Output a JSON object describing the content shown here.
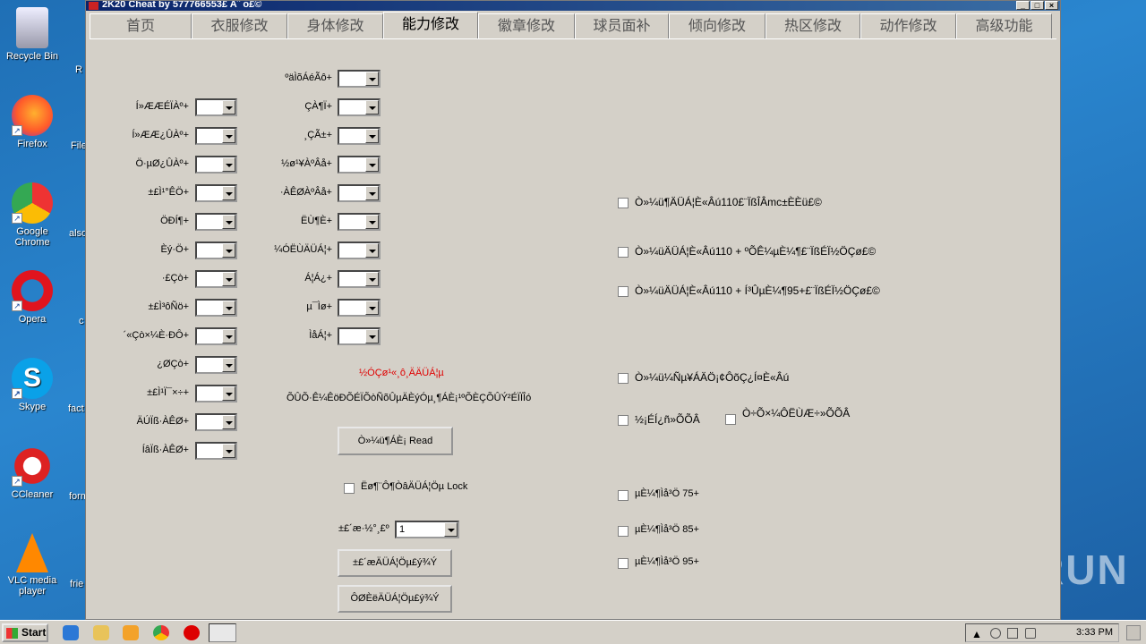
{
  "window": {
    "title": "2K20 Cheat   by 577766553£ A¨ o£©"
  },
  "desktop_icons": [
    {
      "label": "Recycle Bin",
      "name": "recycle-bin-icon"
    },
    {
      "label": "Firefox",
      "name": "firefox-icon"
    },
    {
      "label": "Google Chrome",
      "name": "chrome-icon"
    },
    {
      "label": "Opera",
      "name": "opera-icon"
    },
    {
      "label": "Skype",
      "name": "skype-icon"
    },
    {
      "label": "CCleaner",
      "name": "ccleaner-icon"
    },
    {
      "label": "VLC media player",
      "name": "vlc-icon"
    }
  ],
  "partial_icons": [
    "R",
    "File",
    "also",
    "c",
    "fact",
    "form",
    "frie"
  ],
  "tabs": [
    "首页",
    "衣服修改",
    "身体修改",
    "能力修改",
    "徽章修改",
    "球员面补",
    "倾向修改",
    "热区修改",
    "动作修改",
    "高级功能"
  ],
  "active_tab": "能力修改",
  "left_labels": [
    "Í»ÆÆÉÏÀº+",
    "Í»ÆÆ¿ÛÀº+",
    "Ö·µØ¿ÛÀº+",
    "±£Ì¹°ÊÖ+",
    "ÖÐÍ¶+",
    "Èý·Ö+",
    "·£Çò+",
    "±£Ì³ôÑö+",
    "´«Çò×¼È·ÐÔ+",
    "¿ØÇò+",
    "±£Ì¹Ï¯×÷+",
    "ÄÚÏß·ÀÊØ+",
    "ÍâÏß·ÀÊØ+"
  ],
  "mid_labels": [
    "ºäÌõÁéÃô+",
    "ÇÀ¶Ï+",
    "¸ÇÃ±+",
    "½ø¹¥ÀºÂå+",
    "·ÀÊØÀºÂå+",
    "ËÙ¶È+",
    "¼ÓËÙÄÜÁ¦+",
    "Á¦Á¿+",
    "µ¯Ìø+",
    "ÌåÁ¦+"
  ],
  "messages": {
    "red_note": "½ÓÇø¹«¸ô¸ÄÄÜÁ¦µ",
    "info_line": "ÕÛÕ·Ê¼ÊöÐÕÉÏÕòÑõÛµÄÈýÓµ¸¶ÁÈ¡¹ºÕÈÇÕÛÝ²ÉÏÏÎó"
  },
  "buttons": {
    "read": "Ò»¼ü¶ÁÈ¡ Read",
    "save_ability": "±£´æÄÜÁ¦Öµ£ý¾Ý",
    "load_ability": "ÔØÈëÄÜÁ¦Öµ£ý¾Ý"
  },
  "lock": {
    "label": "Ëø¶¨Ô¶ÒâÄÜÁ¦Öµ Lock"
  },
  "slot": {
    "label": "±£´æ·½°¸£º",
    "value": "1"
  },
  "right_checks": [
    "Ò»¼ü¶ÄÜÁ¦È«Âú110£¨ÏßÎÂmc±ÈÈü£©",
    "Ò»¼üÄÜÁ¦È«Âú110 + ºÕÊ¼µÈ¼¶£¨ÏßÉÏ½ÖÇø£©",
    "Ò»¼üÄÜÁ¦È«Âú110 + Í­³ÛµÈ¼¶95+£¨ÏßÉÏ½ÖÇø£©",
    "Ò»¼ü¼Ñµ¥ÁÄÖ¡¢ÔõÇ¿Í¤È«Âú"
  ],
  "pair_checks": [
    "½¡ÉÍ¿ñ»ÕÕÂ",
    "Ò÷Õ×¼ÔËÙÆ÷»ÕÕÂ"
  ],
  "level_checks": [
    "µÈ¼¶Ìå³Ö 75+",
    "µÈ¼¶Ìå³Ö 85+",
    "µÈ¼¶Ìå³Ö 95+"
  ],
  "taskbar": {
    "start_label": "Start",
    "clock": "3:33 PM"
  },
  "watermark": "ANY RUN"
}
